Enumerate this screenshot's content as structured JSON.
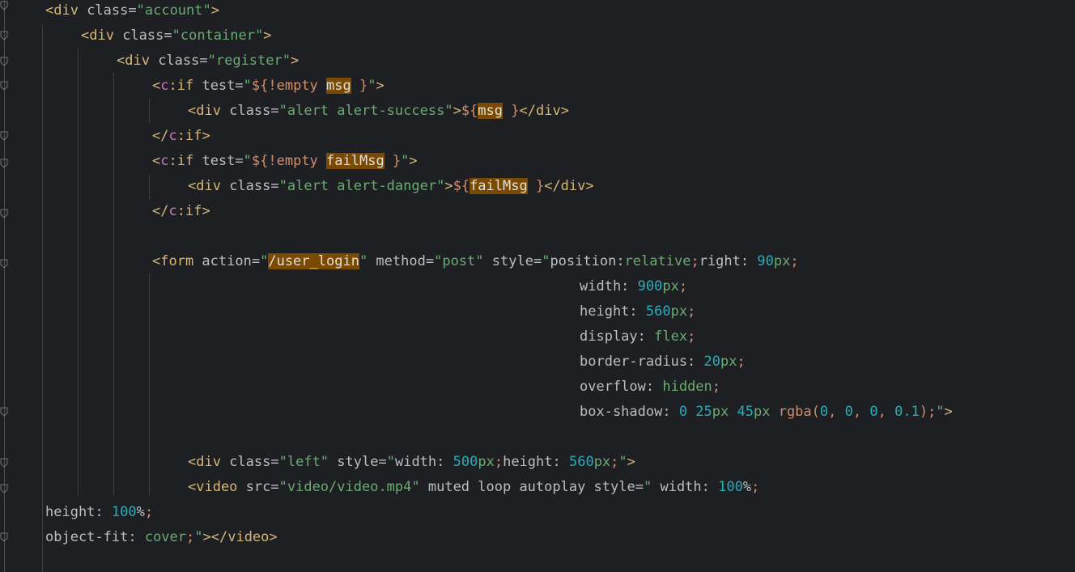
{
  "editor": {
    "lines": [
      [
        {
          "c": "tagc",
          "t": "<div "
        },
        {
          "c": "a",
          "t": "class"
        },
        {
          "c": "eq",
          "t": "="
        },
        {
          "c": "s",
          "t": "\"account\""
        },
        {
          "c": "tagc",
          "t": ">"
        }
      ],
      [
        {
          "c": "tagc",
          "t": "<div "
        },
        {
          "c": "a",
          "t": "class"
        },
        {
          "c": "eq",
          "t": "="
        },
        {
          "c": "s",
          "t": "\"container\""
        },
        {
          "c": "tagc",
          "t": ">"
        }
      ],
      [
        {
          "c": "tagc",
          "t": "<div "
        },
        {
          "c": "a",
          "t": "class"
        },
        {
          "c": "eq",
          "t": "="
        },
        {
          "c": "s",
          "t": "\"register\""
        },
        {
          "c": "tagc",
          "t": ">"
        }
      ],
      [
        {
          "c": "tagc",
          "t": "<"
        },
        {
          "c": "p",
          "t": "c"
        },
        {
          "c": "tagc",
          "t": ":if "
        },
        {
          "c": "a",
          "t": "test"
        },
        {
          "c": "eq",
          "t": "="
        },
        {
          "c": "s",
          "t": "\""
        },
        {
          "c": "x",
          "t": "${!empty "
        },
        {
          "c": "hl",
          "t": "msg"
        },
        {
          "c": "x",
          "t": " }"
        },
        {
          "c": "s",
          "t": "\""
        },
        {
          "c": "tagc",
          "t": ">"
        }
      ],
      [
        {
          "c": "tagc",
          "t": "<div "
        },
        {
          "c": "a",
          "t": "class"
        },
        {
          "c": "eq",
          "t": "="
        },
        {
          "c": "s",
          "t": "\"alert alert-success\""
        },
        {
          "c": "tagc",
          "t": ">"
        },
        {
          "c": "x",
          "t": "${"
        },
        {
          "c": "hl",
          "t": "msg"
        },
        {
          "c": "x",
          "t": " }"
        },
        {
          "c": "tagc",
          "t": "</div>"
        }
      ],
      [
        {
          "c": "tagc",
          "t": "</"
        },
        {
          "c": "p",
          "t": "c"
        },
        {
          "c": "tagc",
          "t": ":if>"
        }
      ],
      [
        {
          "c": "tagc",
          "t": "<"
        },
        {
          "c": "p",
          "t": "c"
        },
        {
          "c": "tagc",
          "t": ":if "
        },
        {
          "c": "a",
          "t": "test"
        },
        {
          "c": "eq",
          "t": "="
        },
        {
          "c": "s",
          "t": "\""
        },
        {
          "c": "x",
          "t": "${!empty "
        },
        {
          "c": "hl",
          "t": "failMsg"
        },
        {
          "c": "x",
          "t": " }"
        },
        {
          "c": "s",
          "t": "\""
        },
        {
          "c": "tagc",
          "t": ">"
        }
      ],
      [
        {
          "c": "tagc",
          "t": "<div "
        },
        {
          "c": "a",
          "t": "class"
        },
        {
          "c": "eq",
          "t": "="
        },
        {
          "c": "s",
          "t": "\"alert alert-danger\""
        },
        {
          "c": "tagc",
          "t": ">"
        },
        {
          "c": "x",
          "t": "${"
        },
        {
          "c": "hl",
          "t": "failMsg"
        },
        {
          "c": "x",
          "t": " }"
        },
        {
          "c": "tagc",
          "t": "</div>"
        }
      ],
      [
        {
          "c": "tagc",
          "t": "</"
        },
        {
          "c": "p",
          "t": "c"
        },
        {
          "c": "tagc",
          "t": ":if>"
        }
      ],
      [],
      [
        {
          "c": "tagc",
          "t": "<form "
        },
        {
          "c": "a",
          "t": "action"
        },
        {
          "c": "eq",
          "t": "="
        },
        {
          "c": "s",
          "t": "\""
        },
        {
          "c": "hl",
          "t": "/user_login"
        },
        {
          "c": "s",
          "t": "\""
        },
        {
          "c": "a",
          "t": " method"
        },
        {
          "c": "eq",
          "t": "="
        },
        {
          "c": "s",
          "t": "\"post\""
        },
        {
          "c": "a",
          "t": " style"
        },
        {
          "c": "eq",
          "t": "="
        },
        {
          "c": "s",
          "t": "\""
        },
        {
          "c": "plain",
          "t": "position:"
        },
        {
          "c": "u",
          "t": "relative"
        },
        {
          "c": "x",
          "t": ";"
        },
        {
          "c": "plain",
          "t": "right: "
        },
        {
          "c": "n",
          "t": "90"
        },
        {
          "c": "u",
          "t": "px"
        },
        {
          "c": "x",
          "t": ";"
        }
      ],
      [
        {
          "c": "plain",
          "t": "width: "
        },
        {
          "c": "n",
          "t": "900"
        },
        {
          "c": "u",
          "t": "px"
        },
        {
          "c": "x",
          "t": ";"
        }
      ],
      [
        {
          "c": "plain",
          "t": "height: "
        },
        {
          "c": "n",
          "t": "560"
        },
        {
          "c": "u",
          "t": "px"
        },
        {
          "c": "x",
          "t": ";"
        }
      ],
      [
        {
          "c": "plain",
          "t": "display: "
        },
        {
          "c": "u",
          "t": "flex"
        },
        {
          "c": "x",
          "t": ";"
        }
      ],
      [
        {
          "c": "plain",
          "t": "border-radius: "
        },
        {
          "c": "n",
          "t": "20"
        },
        {
          "c": "u",
          "t": "px"
        },
        {
          "c": "x",
          "t": ";"
        }
      ],
      [
        {
          "c": "plain",
          "t": "overflow: "
        },
        {
          "c": "u",
          "t": "hidden"
        },
        {
          "c": "x",
          "t": ";"
        }
      ],
      [
        {
          "c": "plain",
          "t": "box-shadow: "
        },
        {
          "c": "n",
          "t": "0 25"
        },
        {
          "c": "u",
          "t": "px "
        },
        {
          "c": "n",
          "t": "45"
        },
        {
          "c": "u",
          "t": "px "
        },
        {
          "c": "x",
          "t": "rgba("
        },
        {
          "c": "n",
          "t": "0"
        },
        {
          "c": "x",
          "t": ", "
        },
        {
          "c": "n",
          "t": "0"
        },
        {
          "c": "x",
          "t": ", "
        },
        {
          "c": "n",
          "t": "0"
        },
        {
          "c": "x",
          "t": ", "
        },
        {
          "c": "n",
          "t": "0.1"
        },
        {
          "c": "x",
          "t": ");"
        },
        {
          "c": "s",
          "t": "\""
        },
        {
          "c": "tagc",
          "t": ">"
        }
      ],
      [],
      [
        {
          "c": "tagc",
          "t": "<div "
        },
        {
          "c": "a",
          "t": "class"
        },
        {
          "c": "eq",
          "t": "="
        },
        {
          "c": "s",
          "t": "\"left\""
        },
        {
          "c": "a",
          "t": " style"
        },
        {
          "c": "eq",
          "t": "="
        },
        {
          "c": "s",
          "t": "\""
        },
        {
          "c": "plain",
          "t": "width: "
        },
        {
          "c": "n",
          "t": "500"
        },
        {
          "c": "u",
          "t": "px"
        },
        {
          "c": "x",
          "t": ";"
        },
        {
          "c": "plain",
          "t": "height: "
        },
        {
          "c": "n",
          "t": "560"
        },
        {
          "c": "u",
          "t": "px"
        },
        {
          "c": "x",
          "t": ";"
        },
        {
          "c": "s",
          "t": "\""
        },
        {
          "c": "tagc",
          "t": ">"
        }
      ],
      [
        {
          "c": "tagc",
          "t": "<video "
        },
        {
          "c": "a",
          "t": "src"
        },
        {
          "c": "eq",
          "t": "="
        },
        {
          "c": "s",
          "t": "\"video/video.mp4\""
        },
        {
          "c": "a",
          "t": " muted loop autoplay style"
        },
        {
          "c": "eq",
          "t": "="
        },
        {
          "c": "s",
          "t": "\""
        },
        {
          "c": "plain",
          "t": " width: "
        },
        {
          "c": "n",
          "t": "100"
        },
        {
          "c": "plain",
          "t": "%"
        },
        {
          "c": "x",
          "t": ";"
        }
      ],
      [
        {
          "c": "plain",
          "t": "height: "
        },
        {
          "c": "n",
          "t": "100"
        },
        {
          "c": "plain",
          "t": "%"
        },
        {
          "c": "x",
          "t": ";"
        }
      ],
      [
        {
          "c": "plain",
          "t": "object-fit: "
        },
        {
          "c": "u",
          "t": "cover"
        },
        {
          "c": "x",
          "t": ";"
        },
        {
          "c": "s",
          "t": "\""
        },
        {
          "c": "tagc",
          "t": "></video>"
        }
      ]
    ]
  }
}
